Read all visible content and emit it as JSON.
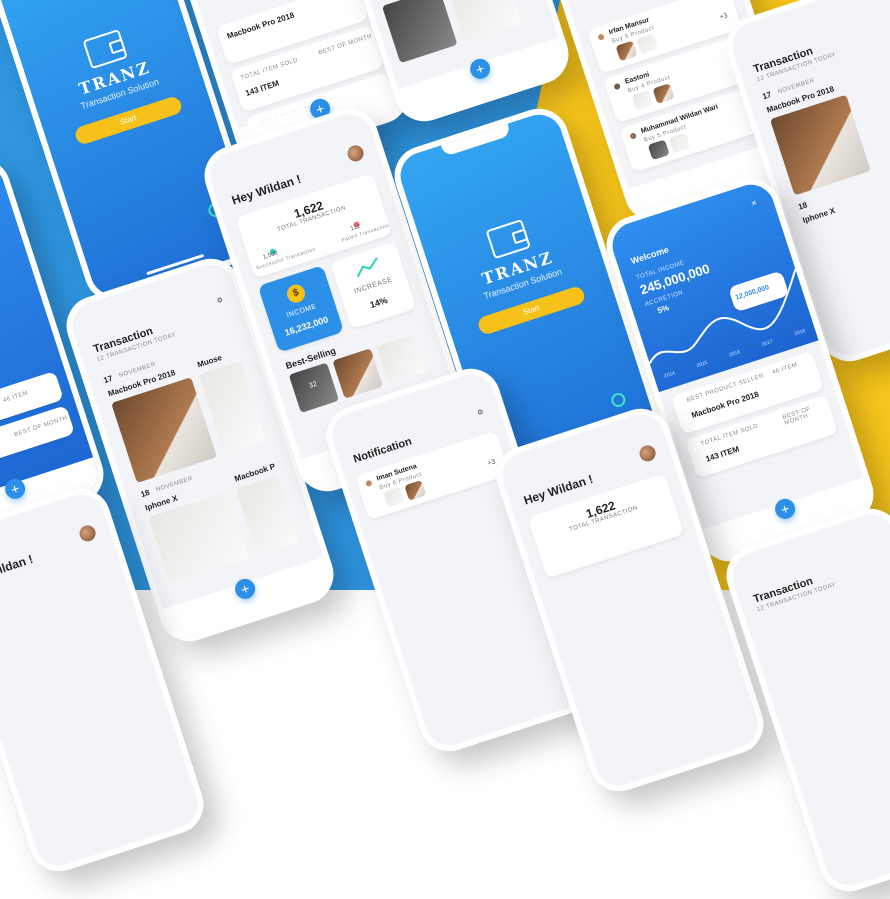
{
  "brand": {
    "name": "TRANZ",
    "tagline": "Transaction Solution",
    "start_label": "Start"
  },
  "home": {
    "greeting": "Hey Wildan !",
    "total_transaction": "1,622",
    "total_transaction_label": "TOTAL TRANSACTION",
    "success_count": "1,500",
    "success_label": "Successful Transaction",
    "failed_count": "122",
    "failed_label": "Failed Transaction",
    "income_label": "INCOME",
    "income_value": "16,232,000",
    "increase_label": "INCREASE",
    "increase_value": "14%",
    "best_selling_label": "Best-Selling",
    "thumb_badge": "32"
  },
  "transaction": {
    "title": "Transaction",
    "subtitle": "12 TRANSACTION TODAY",
    "date1_day": "17",
    "date1_month": "NOVEMBER",
    "item1": "Macbook Pro 2018",
    "item1b": "Muose",
    "date2_day": "18",
    "date2_month": "NOVEMBER",
    "item2": "Iphone X",
    "item2b": "Macbook P"
  },
  "stats": {
    "best_seller_label": "BEST PRODUCT SELLER",
    "best_seller_item": "Macbook Pro 2018",
    "items_label": "46 ITEM",
    "total_item_label": "TOTAL ITEM SOLD",
    "best_month_label": "BEST OF MONTH",
    "total_item_value": "143 ITEM"
  },
  "welcome": {
    "title": "Welcome",
    "income_label": "TOTAL INCOME",
    "income_value": "245,000,000",
    "accretion_label": "ACCRETION",
    "accretion_value": "5%",
    "tooltip_value": "12,000,000",
    "years": [
      "2014",
      "2015",
      "2016",
      "2017",
      "2018"
    ]
  },
  "notification": {
    "title": "Notification",
    "people": [
      {
        "name": "Iman Sutena",
        "detail": "Buy 6 Product"
      },
      {
        "name": "Irfan Mansur",
        "detail": "Buy 5 Product"
      },
      {
        "name": "Eastoni",
        "detail": "Buy 4 Product"
      },
      {
        "name": "Muhammad Wildan Wari",
        "detail": "Buy 5 Product"
      }
    ],
    "more": "+3"
  }
}
